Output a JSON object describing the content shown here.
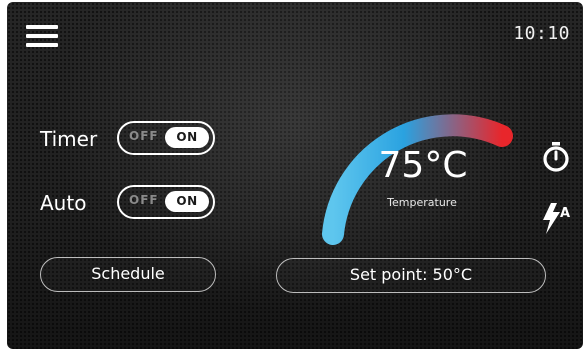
{
  "header": {
    "menu_icon": "hamburger-menu-icon",
    "time": "10:10"
  },
  "timer": {
    "label": "Timer",
    "off_label": "OFF",
    "on_label": "ON",
    "state": "on"
  },
  "auto": {
    "label": "Auto",
    "off_label": "OFF",
    "on_label": "ON",
    "state": "on"
  },
  "schedule_button": {
    "label": "Schedule"
  },
  "setpoint_button": {
    "label": "Set point: 50°C"
  },
  "gauge": {
    "value": "75°C",
    "label": "Temperature",
    "colors": {
      "cool": "#5ec6ee",
      "mid": "#2aa2e0",
      "hot": "#e8262b"
    }
  },
  "side_icons": [
    "stopwatch-icon",
    "auto-flash-icon"
  ]
}
